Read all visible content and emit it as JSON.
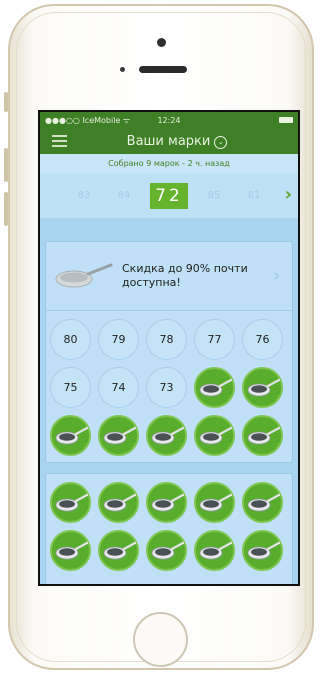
{
  "status_bar": {
    "carrier": "●●●○○ IceMobile ᯤ",
    "time": "12:24"
  },
  "nav": {
    "title": "Ваши марки",
    "chevron": "⌄",
    "menu_icon": "hamburger-icon"
  },
  "subheader": {
    "text": "Собрано 9 марок - 2 ч. назад"
  },
  "pager": {
    "prev_2": "83",
    "prev_1": "84",
    "current": "72",
    "next_1": "85",
    "next_2": "81",
    "next_arrow": "›"
  },
  "promo": {
    "text": "Скидка до 90% почти доступна!",
    "arrow": "›"
  },
  "card1": {
    "row1": [
      "80",
      "79",
      "78",
      "77",
      "76"
    ],
    "row2": [
      "75",
      "74",
      "73"
    ]
  },
  "colors": {
    "header_green": "#3f7f25",
    "stamp_green": "#58ad2c",
    "screen_blue": "#a9d4f0"
  }
}
